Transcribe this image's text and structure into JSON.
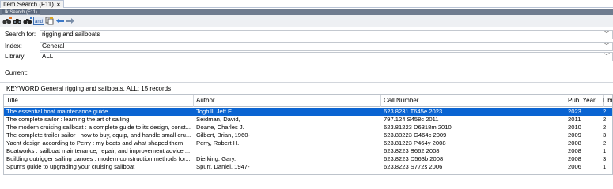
{
  "window": {
    "tab_title": "Item Search (F11)",
    "tab_close": "×",
    "inner_tab": "Ik Search (F11)"
  },
  "toolbar": {
    "buttons": [
      {
        "icon": "binoculars-add-icon"
      },
      {
        "icon": "binoculars-icon"
      },
      {
        "icon": "binoculars-search-icon"
      },
      {
        "icon": "and-operator-icon"
      },
      {
        "icon": "copy-icon"
      },
      {
        "icon": "arrow-left-icon"
      },
      {
        "icon": "arrow-right-icon"
      }
    ]
  },
  "form": {
    "search_label": "Search for:",
    "search_value": "rigging and sailboats",
    "index_label": "Index:",
    "index_value": "General",
    "library_label": "Library:",
    "library_value": "ALL",
    "current_label": "Current:"
  },
  "results": {
    "summary": "KEYWORD General  rigging and sailboats, ALL: 15 records",
    "columns": [
      "Title",
      "Author",
      "Call Number",
      "Pub. Year",
      "Libr"
    ],
    "rows": [
      [
        "The essential boat maintenance guide",
        "Toghill, Jeff E.",
        "623.8231 T645e 2023",
        "2023",
        "2"
      ],
      [
        "The complete sailor : learning the art of sailing",
        "Seidman, David,",
        "797.124 S458c 2011",
        "2011",
        "2"
      ],
      [
        "The modern cruising sailboat : a complete guide to its design, const...",
        "Doane, Charles J.",
        "623.81223 D6318m 2010",
        "2010",
        "2"
      ],
      [
        "The complete trailer sailor : how to buy, equip, and handle small cru...",
        "Gilbert, Brian, 1960-",
        "623.88223 G464c 2009",
        "2009",
        "3"
      ],
      [
        "Yacht design according to Perry : my boats and what shaped them",
        "Perry, Robert H.",
        "623.81223 P464y 2008",
        "2008",
        "2"
      ],
      [
        "Boatworks : sailboat maintenance, repair, and improvement advice ...",
        "",
        "623.8223 B662 2008",
        "2008",
        "1"
      ],
      [
        "Building outrigger sailing canoes : modern construction methods for...",
        "Dierking, Gary.",
        "623.8223 D563b 2008",
        "2008",
        "3"
      ],
      [
        "Spurr's guide to upgrading your cruising sailboat",
        "Spurr, Daniel, 1947-",
        "623.8223 S772s 2006",
        "2006",
        "1"
      ]
    ]
  },
  "colors": {
    "selection": "#0a64d2",
    "toolbar_bg": "#eef0f3",
    "inner_tab_bg": "#6f7c8f"
  }
}
